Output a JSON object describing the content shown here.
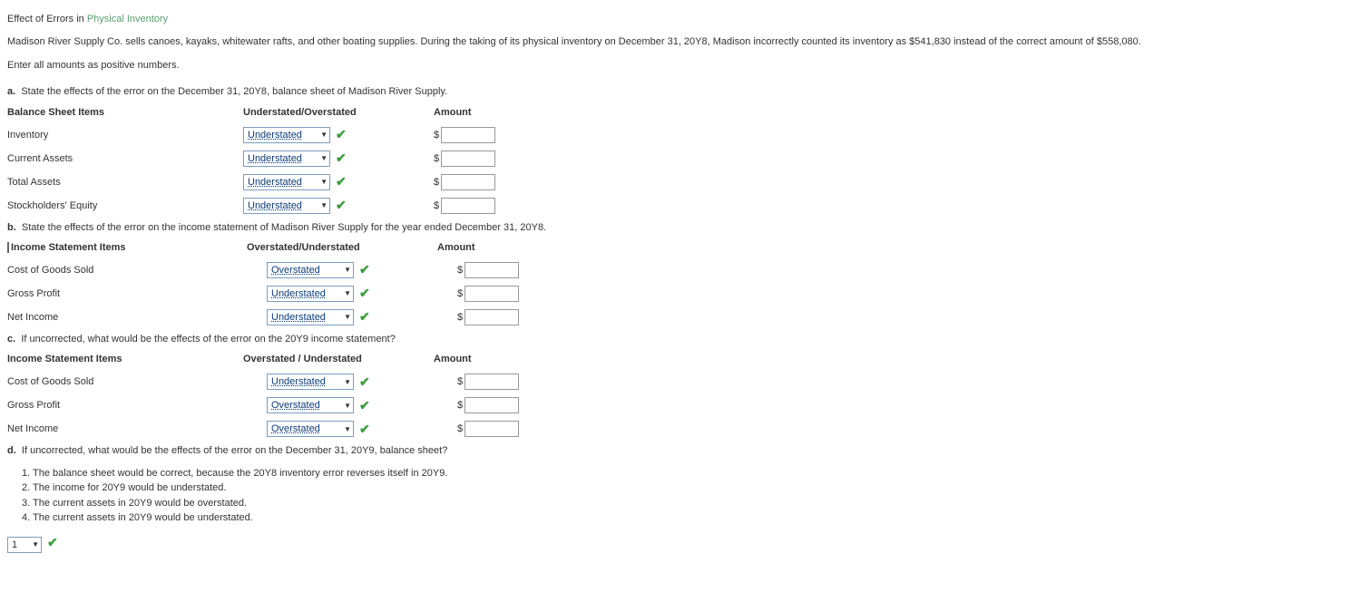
{
  "title": {
    "prefix": "Effect of Errors in ",
    "link": "Physical Inventory"
  },
  "intro": "Madison River Supply Co. sells canoes, kayaks, whitewater rafts, and other boating supplies. During the taking of its physical inventory on December 31, 20Y8, Madison incorrectly counted its inventory as $541,830 instead of the correct amount of $558,080.",
  "instruction": "Enter all amounts as positive numbers.",
  "partA": {
    "label": "a.",
    "text": "State the effects of the error on the December 31, 20Y8, balance sheet of Madison River Supply.",
    "h1": "Balance Sheet Items",
    "h2": "Understated/Overstated",
    "h3": "Amount",
    "rows": [
      {
        "item": "Inventory",
        "sel": "Understated"
      },
      {
        "item": "Current Assets",
        "sel": "Understated"
      },
      {
        "item": "Total Assets",
        "sel": "Understated"
      },
      {
        "item": "Stockholders' Equity",
        "sel": "Understated"
      }
    ]
  },
  "partB": {
    "label": "b.",
    "text": "State the effects of the error on the income statement of Madison River Supply for the year ended December 31, 20Y8.",
    "h1": "Income Statement Items",
    "h2": "Overstated/Understated",
    "h3": "Amount",
    "rows": [
      {
        "item": "Cost of Goods Sold",
        "sel": "Overstated"
      },
      {
        "item": "Gross Profit",
        "sel": "Understated"
      },
      {
        "item": "Net Income",
        "sel": "Understated"
      }
    ]
  },
  "partC": {
    "label": "c.",
    "text": "If uncorrected, what would be the effects of the error on the 20Y9 income statement?",
    "h1": "Income Statement Items",
    "h2": "Overstated / Understated",
    "h3": "Amount",
    "rows": [
      {
        "item": "Cost of Goods Sold",
        "sel": "Understated"
      },
      {
        "item": "Gross Profit",
        "sel": "Overstated"
      },
      {
        "item": "Net Income",
        "sel": "Overstated"
      }
    ]
  },
  "partD": {
    "label": "d.",
    "text": "If uncorrected, what would be the effects of the error on the December 31, 20Y9, balance sheet?",
    "options": [
      "1. The balance sheet would be correct, because the 20Y8 inventory error reverses itself in 20Y9.",
      "2. The income for 20Y9 would be understated.",
      "3. The current assets in 20Y9 would be overstated.",
      "4. The current assets in 20Y9 would be understated."
    ],
    "answer": "1"
  },
  "symbols": {
    "dollar": "$",
    "check": "✔",
    "caret": "▼"
  }
}
